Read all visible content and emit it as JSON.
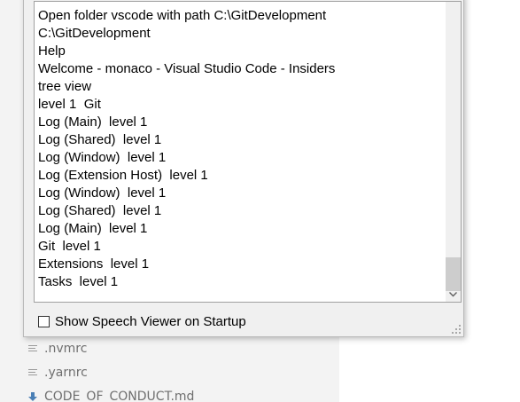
{
  "speech_viewer": {
    "lines": [
      "Open folder vscode with path C:\\GitDevelopment",
      "C:\\GitDevelopment",
      "Help",
      "Welcome - monaco - Visual Studio Code - Insiders",
      "tree view",
      "level 1  Git",
      "Log (Main)  level 1",
      "Log (Shared)  level 1",
      "Log (Window)  level 1",
      "Log (Extension Host)  level 1",
      "Log (Window)  level 1",
      "Log (Shared)  level 1",
      "Log (Main)  level 1",
      "Git  level 1",
      "Extensions  level 1",
      "Tasks  level 1"
    ],
    "show_on_startup_label": "Show Speech Viewer on Startup",
    "show_on_startup_checked": false
  },
  "explorer": {
    "files": [
      {
        "name": "",
        "icon": "lines-icon"
      },
      {
        "name": ".nvmrc",
        "icon": "lines-icon"
      },
      {
        "name": ".yarnrc",
        "icon": "lines-icon"
      },
      {
        "name": "CODE_OF_CONDUCT.md",
        "icon": "download-arrow-icon"
      }
    ]
  }
}
